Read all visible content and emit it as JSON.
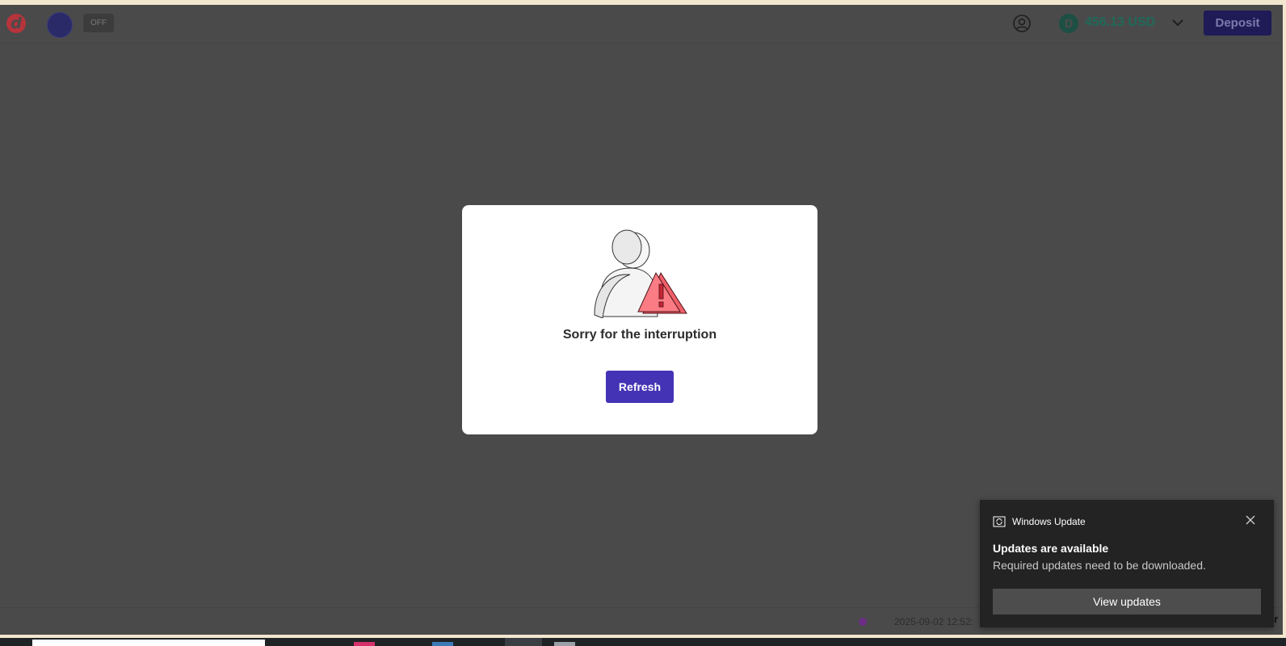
{
  "header": {
    "toggle_label": "OFF",
    "balance": "456.13 USD",
    "deposit_label": "Deposit"
  },
  "modal": {
    "title": "Sorry for the interruption",
    "refresh_label": "Refresh"
  },
  "status_bar": {
    "timestamp": "2025-09-02 12:52:",
    "edge_text": "er"
  },
  "notification": {
    "app_name": "Windows Update",
    "title": "Updates are available",
    "body": "Required updates need to be downloaded.",
    "button_label": "View updates"
  },
  "colors": {
    "brand_accent": "#4433b4",
    "balance_green": "#1f6a59",
    "warning_red": "#f0606a"
  },
  "icons": {
    "logo": "app-logo-icon",
    "profile": "user-circle-icon",
    "coin": "coin-icon",
    "expand": "chevron-down-icon",
    "illustration": "user-warning-icon",
    "notification_app": "windows-update-icon",
    "close": "close-icon"
  }
}
